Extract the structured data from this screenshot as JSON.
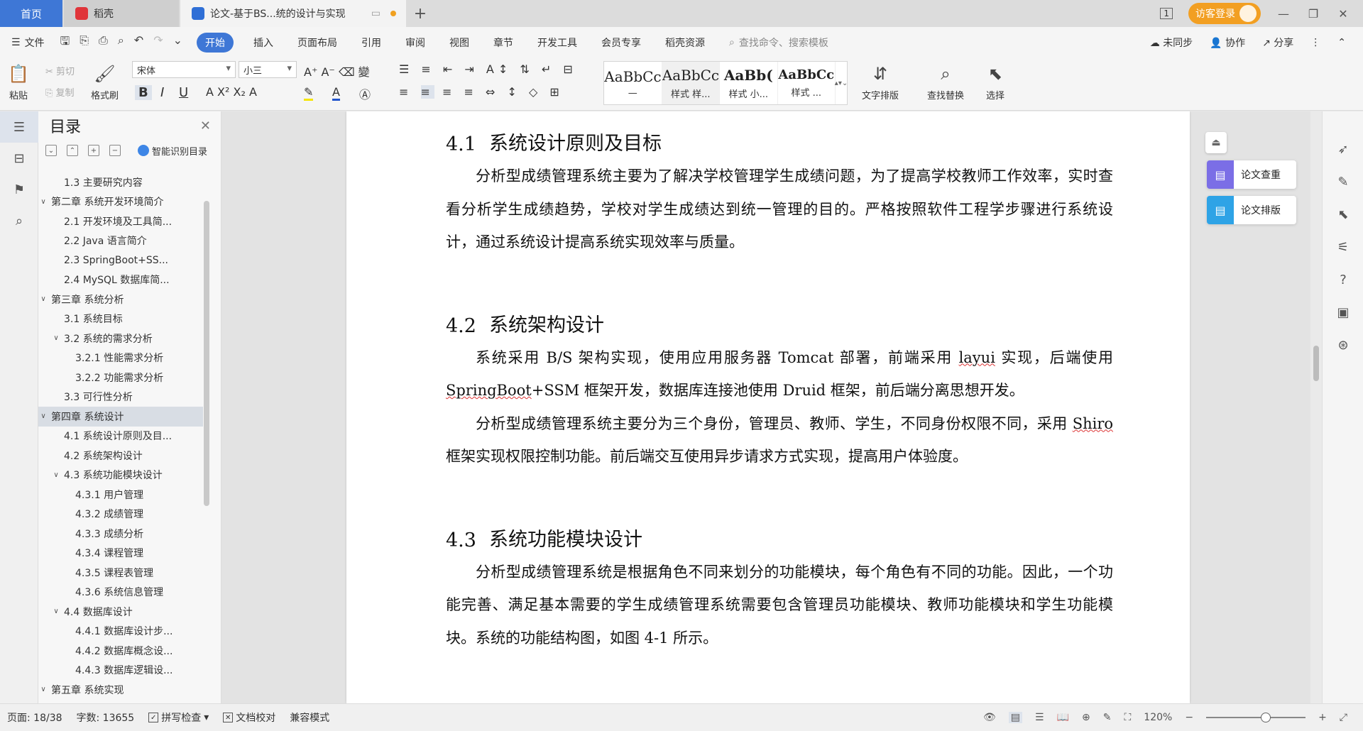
{
  "tabs": {
    "home": "首页",
    "app_tab": "稻壳",
    "doc_tab": "论文-基于BS...统的设计与实现",
    "add": "+",
    "guest_login": "访客登录",
    "page_indicator": "1"
  },
  "menu": {
    "file": "文件",
    "items": [
      "开始",
      "插入",
      "页面布局",
      "引用",
      "审阅",
      "视图",
      "章节",
      "开发工具",
      "会员专享",
      "稻壳资源"
    ],
    "search_placeholder": "查找命令、搜索模板",
    "sync": "未同步",
    "collab": "协作",
    "share": "分享"
  },
  "ribbon": {
    "paste": "粘贴",
    "cut": "剪切",
    "copy": "复制",
    "format_painter": "格式刷",
    "font": "宋体",
    "size": "小三",
    "styles": [
      {
        "sample": "AaBbCc",
        "name": "—"
      },
      {
        "sample": "AaBbCc",
        "name": "样式 样..."
      },
      {
        "sample": "AaBb(",
        "name": "样式 小..."
      },
      {
        "sample": "AaBbCc",
        "name": "样式 ..."
      }
    ],
    "text_layout": "文字排版",
    "find_replace": "查找替换",
    "select": "选择"
  },
  "toc": {
    "title": "目录",
    "smart": "智能识别目录",
    "items": [
      {
        "level": 2,
        "text": "1.3  主要研究内容",
        "arrow": ""
      },
      {
        "level": 1,
        "text": "第二章  系统开发环境简介",
        "arrow": "v"
      },
      {
        "level": 2,
        "text": "2.1  开发环境及工具简...",
        "arrow": ""
      },
      {
        "level": 2,
        "text": "2.2  Java 语言简介",
        "arrow": ""
      },
      {
        "level": 2,
        "text": "2.3  SpringBoot+SS...",
        "arrow": ""
      },
      {
        "level": 2,
        "text": "2.4  MySQL 数据库简...",
        "arrow": ""
      },
      {
        "level": 1,
        "text": "第三章  系统分析",
        "arrow": "v"
      },
      {
        "level": 2,
        "text": "3.1  系统目标",
        "arrow": ""
      },
      {
        "level": 2,
        "text": "3.2  系统的需求分析",
        "arrow": "v"
      },
      {
        "level": 3,
        "text": "3.2.1  性能需求分析",
        "arrow": ""
      },
      {
        "level": 3,
        "text": "3.2.2  功能需求分析",
        "arrow": ""
      },
      {
        "level": 2,
        "text": "3.3  可行性分析",
        "arrow": ""
      },
      {
        "level": 1,
        "text": "第四章  系统设计",
        "arrow": "v",
        "selected": true
      },
      {
        "level": 2,
        "text": "4.1  系统设计原则及目...",
        "arrow": ""
      },
      {
        "level": 2,
        "text": "4.2  系统架构设计",
        "arrow": ""
      },
      {
        "level": 2,
        "text": "4.3  系统功能模块设计",
        "arrow": "v"
      },
      {
        "level": 3,
        "text": "4.3.1  用户管理",
        "arrow": ""
      },
      {
        "level": 3,
        "text": "4.3.2  成绩管理",
        "arrow": ""
      },
      {
        "level": 3,
        "text": "4.3.3  成绩分析",
        "arrow": ""
      },
      {
        "level": 3,
        "text": "4.3.4  课程管理",
        "arrow": ""
      },
      {
        "level": 3,
        "text": "4.3.5  课程表管理",
        "arrow": ""
      },
      {
        "level": 3,
        "text": "4.3.6  系统信息管理",
        "arrow": ""
      },
      {
        "level": 2,
        "text": "4.4  数据库设计",
        "arrow": "v"
      },
      {
        "level": 3,
        "text": "4.4.1  数据库设计步...",
        "arrow": ""
      },
      {
        "level": 3,
        "text": "4.4.2  数据库概念设...",
        "arrow": ""
      },
      {
        "level": 3,
        "text": "4.4.3  数据库逻辑设...",
        "arrow": ""
      },
      {
        "level": 1,
        "text": "第五章  系统实现",
        "arrow": "v"
      }
    ]
  },
  "document": {
    "s41_num": "4.1",
    "s41_title": "系统设计原则及目标",
    "s41_p1": "分析型成绩管理系统主要为了解决学校管理学生成绩问题，为了提高学校教师工作效率，实时查看分析学生成绩趋势，学校对学生成绩达到统一管理的目的。严格按照软件工程学步骤进行系统设计，通过系统设计提高系统实现效率与质量。",
    "s42_num": "4.2",
    "s42_title": "系统架构设计",
    "s42_p1_a": "系统采用 B/S 架构实现，使用应用服务器 Tomcat 部署，前端采用 ",
    "s42_p1_layui": "layui",
    "s42_p1_b": " 实现，后端使用 ",
    "s42_p1_sb": "SpringBoot",
    "s42_p1_c": "+SSM 框架开发，数据库连接池使用 Druid 框架，前后端分离思想开发。",
    "s42_p2_a": "分析型成绩管理系统主要分为三个身份，管理员、教师、学生，不同身份权限不同，采用 ",
    "s42_p2_shiro": "Shiro",
    "s42_p2_b": " 框架实现权限控制功能。前后端交互使用异步请求方式实现，提高用户体验度。",
    "s43_num": "4.3",
    "s43_title": "系统功能模块设计",
    "s43_p1": "分析型成绩管理系统是根据角色不同来划分的功能模块，每个角色有不同的功能。因此，一个功能完善、满足基本需要的学生成绩管理系统需要包含管理员功能模块、教师功能模块和学生功能模块。系统的功能结构图，如图 4-1 所示。"
  },
  "float_buttons": {
    "check": "论文查重",
    "layout": "论文排版"
  },
  "status": {
    "page": "页面: 18/38",
    "words": "字数: 13655",
    "spell": "拼写检查",
    "proof": "文档校对",
    "compat": "兼容模式",
    "zoom": "120%",
    "zoom_fraction": 0.6
  },
  "colors": {
    "accent": "#3e77d6",
    "guest": "#f29f22"
  }
}
